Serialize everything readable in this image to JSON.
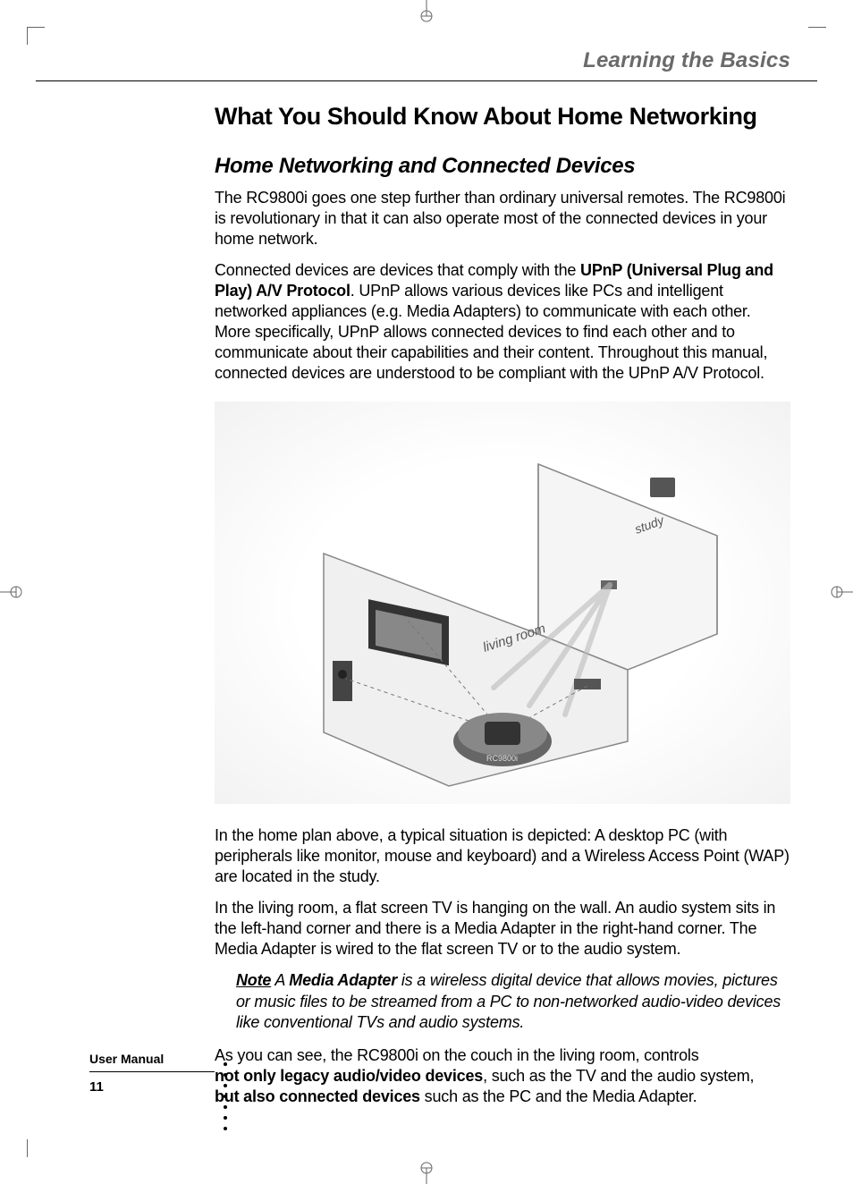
{
  "chapter": "Learning the Basics",
  "h1": "What You Should Know About Home Networking",
  "h2": "Home Networking and Connected Devices",
  "p1": "The RC9800i goes one step further than ordinary universal remotes. The RC9800i is revolutionary in that it can also operate most of the connected devices in your home network.",
  "p2_a": "Connected devices are devices that comply with the ",
  "p2_b": "UPnP (Universal Plug and Play) A/V Protocol",
  "p2_c": ". UPnP allows various devices like PCs and intelligent networked appliances (e.g. Media Adapters) to communicate with each other. More specifically, UPnP allows connected devices to find each other and to communicate about their capabilities and their content. Throughout this manual, connected devices are understood to be compliant with the UPnP A/V Protocol.",
  "figure_labels": {
    "study": "study",
    "living_room": "living room",
    "device": "RC9800i"
  },
  "p3": "In the home plan above, a typical situation is depicted: A desktop PC (with peripherals like monitor, mouse and keyboard) and a Wireless Access Point (WAP) are located in the study.",
  "p4": "In the living room, a flat screen TV is hanging on the wall. An audio system sits in the left-hand corner and there is a Media Adapter in the right-hand corner. The Media Adapter is wired to the flat screen TV or to the audio system.",
  "note_label": "Note",
  "note_a": " A ",
  "note_b": "Media Adapter",
  "note_c": " is a wireless digital device that allows movies, pictures or music files to be streamed from a PC to non-networked audio-video devices like conventional TVs and audio systems.",
  "p5_a": "As you can see, the RC9800i on the couch in the living room, controls ",
  "p5_b": "not only legacy audio/video devices",
  "p5_c": ", such as the TV and the audio system, ",
  "p5_d": "but also connected devices",
  "p5_e": " such as the PC and the Media Adapter.",
  "footer": {
    "label": "User Manual",
    "page": "11"
  }
}
